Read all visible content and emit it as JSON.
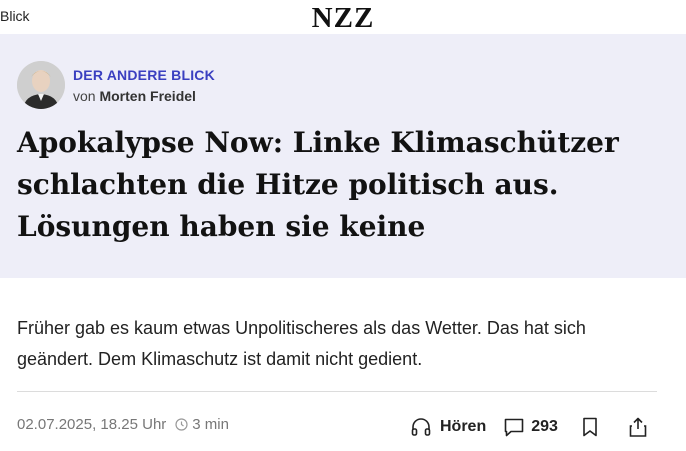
{
  "topbar": {
    "back_label": "Blick",
    "logo": "NZZ"
  },
  "author": {
    "kicker": "DER ANDERE BLICK",
    "byline_prefix": "von",
    "name": "Morten Freidel"
  },
  "article": {
    "headline": "Apokalypse Now: Linke Klimaschützer schlachten die Hitze politisch aus. Lösungen haben sie keine",
    "lead": "Früher gab es kaum etwas Unpolitischeres als das Wetter. Das hat sich geändert. Dem Klimaschutz ist damit nicht gedient.",
    "date": "02.07.2025, 18.25 Uhr",
    "read_time": "3 min"
  },
  "actions": {
    "listen_label": "Hören",
    "comments_count": "293"
  },
  "icons": [
    "clock-icon",
    "headphones-icon",
    "comment-icon",
    "bookmark-icon",
    "share-icon"
  ],
  "colors": {
    "hero_bg": "#eeeef8",
    "kicker": "#3a3fc0"
  }
}
